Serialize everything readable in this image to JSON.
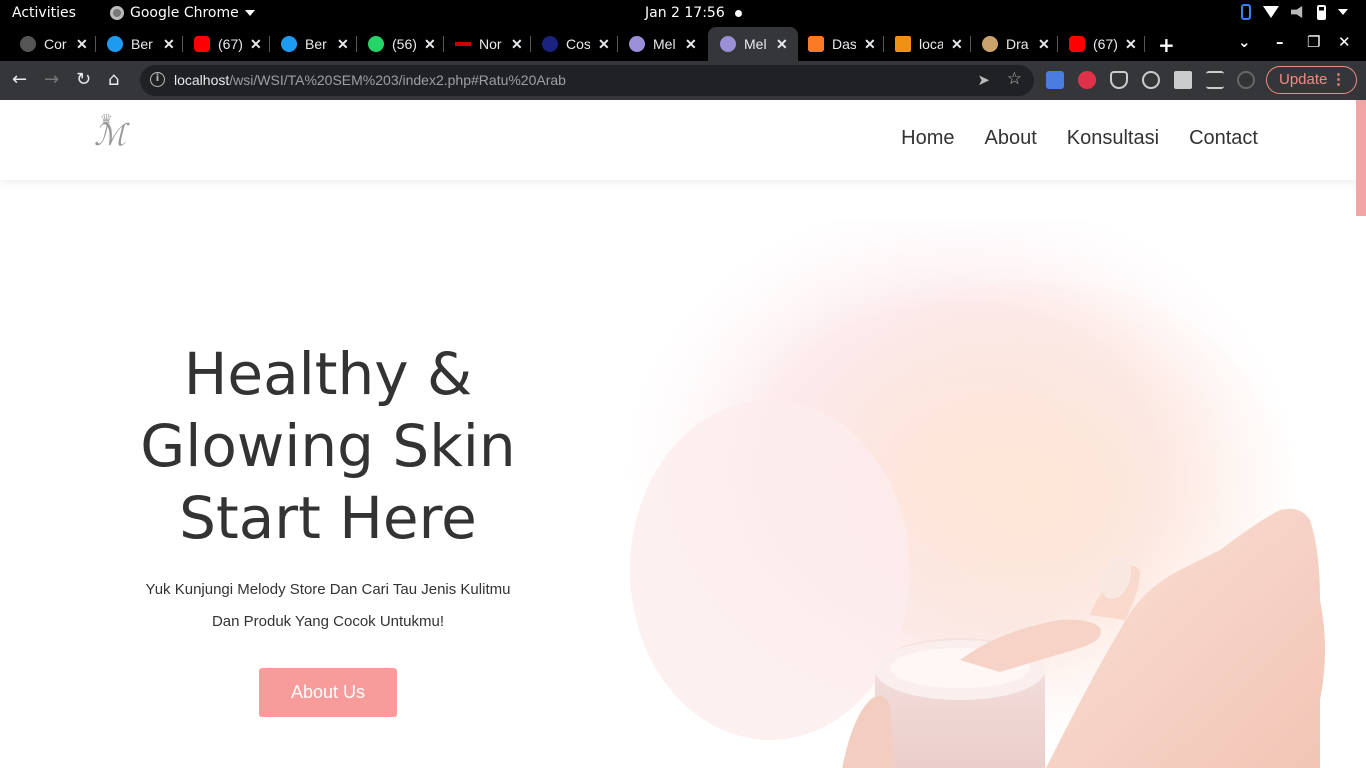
{
  "system": {
    "activities": "Activities",
    "app_name": "Google Chrome",
    "clock": "Jan 2  17:56"
  },
  "tabs": [
    {
      "title": "Cor",
      "icon": "github-icon",
      "color": "#555555"
    },
    {
      "title": "Ber",
      "icon": "twitter-icon",
      "color": "#1d9bf0"
    },
    {
      "title": "(67)",
      "icon": "youtube-icon",
      "color": "#ff0000"
    },
    {
      "title": "Ber",
      "icon": "twitter-icon",
      "color": "#1d9bf0"
    },
    {
      "title": "(56)",
      "icon": "whatsapp-icon",
      "color": "#25d366"
    },
    {
      "title": "Nor",
      "icon": "site-icon",
      "color": "#cc0000"
    },
    {
      "title": "Cos",
      "icon": "site-icon",
      "color": "#1a237e"
    },
    {
      "title": "Mel",
      "icon": "melody-icon",
      "color": "#9b8fd8"
    },
    {
      "title": "Mel",
      "icon": "melody-icon",
      "color": "#9b8fd8",
      "active": true
    },
    {
      "title": "Das",
      "icon": "xampp-icon",
      "color": "#fb7a24"
    },
    {
      "title": "loca",
      "icon": "phpmyadmin-icon",
      "color": "#f29111"
    },
    {
      "title": "Dra",
      "icon": "site-icon",
      "color": "#c9a36b"
    },
    {
      "title": "(67)",
      "icon": "youtube-icon",
      "color": "#ff0000"
    }
  ],
  "toolbar": {
    "url_host": "localhost",
    "url_path": "/wsi/WSI/TA%20SEM%203/index2.php#Ratu%20Arab",
    "update_label": "Update"
  },
  "site": {
    "nav": {
      "items": [
        "Home",
        "About",
        "Konsultasi",
        "Contact"
      ]
    },
    "hero": {
      "title_line1": "Healthy &",
      "title_line2": "Glowing Skin",
      "title_line3": "Start Here",
      "subtitle_line1": "Yuk Kunjungi Melody Store Dan Cari Tau Jenis Kulitmu",
      "subtitle_line2": "Dan Produk Yang Cocok Untukmu!",
      "cta_label": "About Us"
    },
    "colors": {
      "accent": "#f79b9b"
    }
  }
}
